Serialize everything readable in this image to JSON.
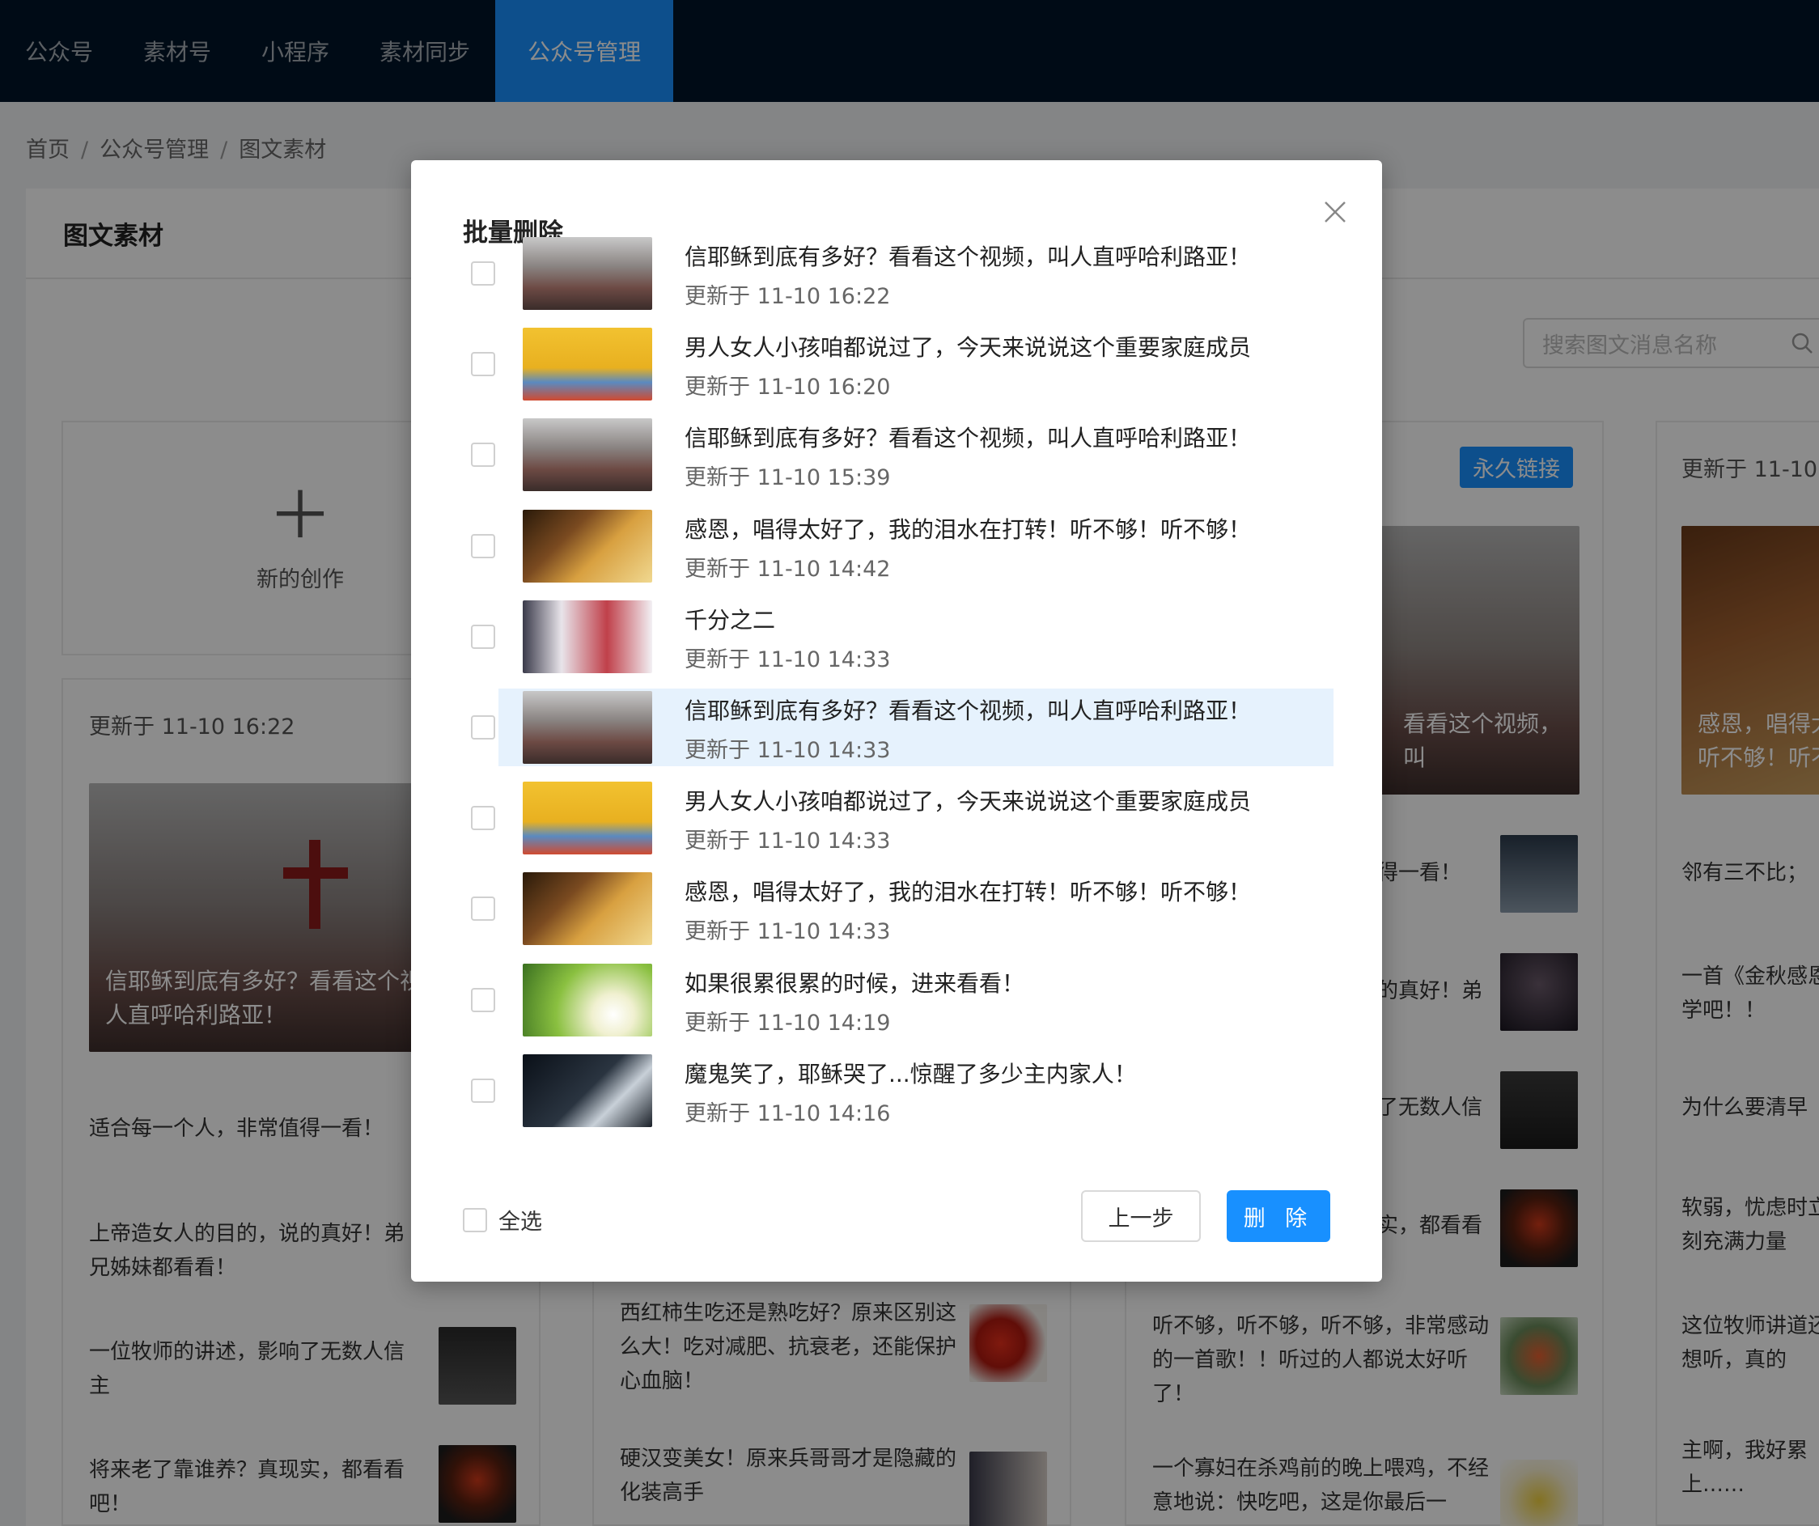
{
  "nav": {
    "items": [
      "公众号",
      "素材号",
      "小程序",
      "素材同步",
      "公众号管理"
    ],
    "active": 4
  },
  "breadcrumb": [
    "首页",
    "公众号管理",
    "图文素材"
  ],
  "panel": {
    "title": "图文素材"
  },
  "search": {
    "placeholder": "搜索图文消息名称"
  },
  "new_card": {
    "label": "新的创作"
  },
  "bg": {
    "upd1": "更新于 11-10 16:22",
    "upd4": "更新于 11-10",
    "badge": "永久链接",
    "cover1": "信耶稣到底有多好？看看这个视频，叫人直呼哈利路亚！",
    "cover3": "看看这个视频，叫",
    "cover4": "感恩，唱得太\n听不够！听不",
    "col1": [
      "适合每一个人，非常值得一看！",
      "上帝造女人的目的，说的真好！弟兄姊妹都看看！",
      "一位牧师的讲述，影响了无数人信主",
      "将来老了靠谁养？真现实，都看看吧！"
    ],
    "col2": [
      "西红柿生吃还是熟吃好？原来区别这么大！吃对减肥、抗衰老，还能保护心血脑！",
      "硬汉变美女！原来兵哥哥才是隐藏的化装高手"
    ],
    "col3": [
      "得一看！",
      "的真好！弟",
      "了无数人信",
      "实，都看看",
      "听不够，听不够，听不够，非常感动的一首歌！！听过的人都说太好听了！",
      "一个寡妇在杀鸡前的晚上喂鸡，不经意地说：快吃吧，这是你最后一"
    ],
    "col4": [
      "邻有三不比；",
      "一首《金秋感恩》学吧！！",
      "为什么要清早",
      "软弱，忧虑时立刻充满力量",
      "这位牧师讲道还想听，真的",
      "主啊，我好累上……"
    ]
  },
  "modal": {
    "title": "批量删除",
    "rows": [
      {
        "title": "信耶稣到底有多好？看看这个视频，叫人直呼哈利路亚！",
        "time": "更新于 11-10 16:22",
        "img": "church"
      },
      {
        "title": "男人女人小孩咱都说过了，今天来说说这个重要家庭成员",
        "time": "更新于 11-10 16:20",
        "img": "man"
      },
      {
        "title": "信耶稣到底有多好？看看这个视频，叫人直呼哈利路亚！",
        "time": "更新于 11-10 15:39",
        "img": "church"
      },
      {
        "title": "感恩，唱得太好了，我的泪水在打转！听不够！听不够！",
        "time": "更新于 11-10 14:42",
        "img": "anime"
      },
      {
        "title": "千分之二",
        "time": "更新于 11-10 14:33",
        "img": "woman"
      },
      {
        "title": "信耶稣到底有多好？看看这个视频，叫人直呼哈利路亚！",
        "time": "更新于 11-10 14:33",
        "img": "church"
      },
      {
        "title": "男人女人小孩咱都说过了，今天来说说这个重要家庭成员",
        "time": "更新于 11-10 14:33",
        "img": "man"
      },
      {
        "title": "感恩，唱得太好了，我的泪水在打转！听不够！听不够！",
        "time": "更新于 11-10 14:33",
        "img": "anime"
      },
      {
        "title": "如果很累很累的时候，进来看看！",
        "time": "更新于 11-10 14:19",
        "img": "flower"
      },
      {
        "title": "魔鬼笑了，耶稣哭了...惊醒了多少主内家人！",
        "time": "更新于 11-10 14:16",
        "img": "dark"
      }
    ],
    "highlight_index": 5,
    "select_all": "全选",
    "prev_button": "上一步",
    "delete_button": "删 除"
  },
  "colors": {
    "nav_bg": "#001529",
    "accent": "#1890ff",
    "highlight": "#e6f2fd"
  }
}
